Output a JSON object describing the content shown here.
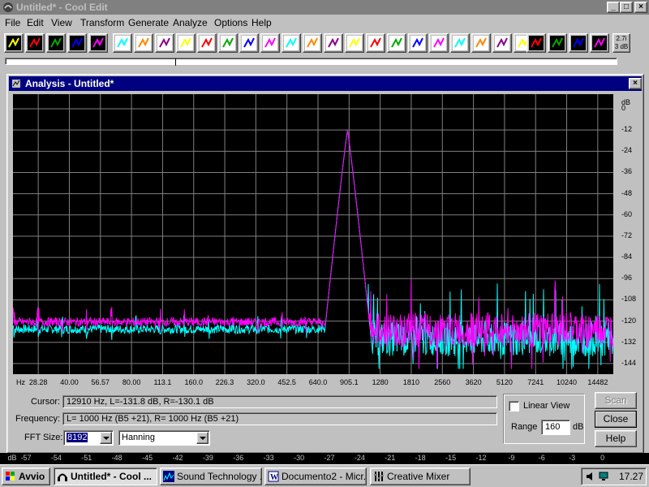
{
  "app": {
    "title": "Untitled* - Cool Edit",
    "window_buttons": [
      "_",
      "□",
      "×"
    ]
  },
  "menu": [
    "File",
    "Edit",
    "View",
    "Transform",
    "Generate",
    "Analyze",
    "Options",
    "Help"
  ],
  "toolbar": {
    "icons": [
      "new-icon",
      "open-icon",
      "save-icon",
      "cue-icon",
      "headphones-icon",
      "rewind-icon",
      "silence-icon",
      "loop-icon",
      "note-icon",
      "record-dot-icon",
      "mix-icon",
      "down-arrow-icon",
      "amplitude-icon",
      "spectrum-icon",
      "timer-icon",
      "echo-icon",
      "filter-icon",
      "reverb-icon",
      "flanger-icon",
      "chorus-icon",
      "eq-icon",
      "noise-icon",
      "wave-icon",
      "brainwave-icon",
      "stretch-icon",
      "envelope-a-icon",
      "envelope-b-icon",
      "envelope-c-icon",
      "envelope-d-icon"
    ],
    "readout_line1": "2.7i",
    "readout_line2": "3 dB"
  },
  "analysis": {
    "title": "Analysis - Untitled*",
    "close_glyph": "×",
    "y_unit": "dB",
    "x_unit": "Hz",
    "cursor_label": "Cursor:",
    "cursor_value": "12910 Hz, L=-131.8 dB, R=-130.1 dB",
    "frequency_label": "Frequency:",
    "frequency_value": "L=   1000 Hz (B5 +21), R=   1000 Hz (B5 +21)",
    "fft_label": "FFT Size:",
    "fft_value": "8192",
    "window_value": "Hanning",
    "linear_view_label": "Linear View",
    "linear_view_checked": false,
    "range_label": "Range",
    "range_value": "160",
    "range_unit": "dB",
    "buttons": {
      "scan": "Scan",
      "close": "Close",
      "help": "Help"
    },
    "colors": {
      "left_channel": "#00ffff",
      "right_channel": "#ff00ff",
      "grid": "#808080"
    }
  },
  "chart_data": {
    "type": "line",
    "xlabel": "Hz",
    "ylabel": "dB",
    "x_ticks": [
      "28.28",
      "40.00",
      "56.57",
      "80.00",
      "113.1",
      "160.0",
      "226.3",
      "320.0",
      "452.5",
      "640.0",
      "905.1",
      "1280",
      "1810",
      "2560",
      "3620",
      "5120",
      "7241",
      "10240",
      "14482"
    ],
    "y_ticks": [
      "0",
      "-12",
      "-24",
      "-36",
      "-48",
      "-60",
      "-72",
      "-84",
      "-96",
      "-108",
      "-120",
      "-132",
      "-144"
    ],
    "ylim": [
      -150,
      0
    ],
    "grid": true,
    "peak": {
      "frequency_hz": 1000,
      "level_db": -12
    },
    "series": [
      {
        "channel": "L",
        "color": "#00ffff",
        "noise_floor_low_db": -125,
        "noise_floor_high_db": -132
      },
      {
        "channel": "R",
        "color": "#ff00ff",
        "noise_floor_low_db": -122,
        "noise_floor_high_db": -128
      }
    ]
  },
  "meter": {
    "labels": [
      "dB",
      "-57",
      "-54",
      "-51",
      "-48",
      "-45",
      "-42",
      "-39",
      "-36",
      "-33",
      "-30",
      "-27",
      "-24",
      "-21",
      "-18",
      "-15",
      "-12",
      "-9",
      "-6",
      "-3",
      "0"
    ]
  },
  "taskbar": {
    "start": "Avvio",
    "tasks": [
      "Untitled* - Cool ...",
      "Sound Technology ...",
      "Documento2 - Micr...",
      "Creative Mixer"
    ],
    "clock": "17.27"
  }
}
